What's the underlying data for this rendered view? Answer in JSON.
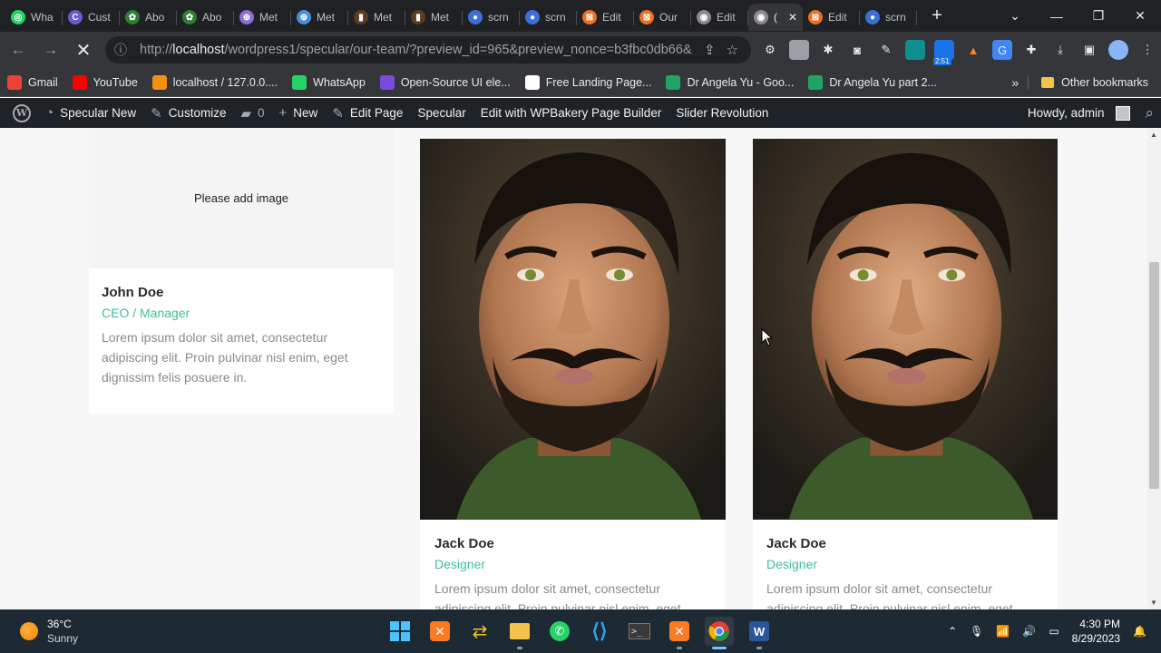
{
  "browser": {
    "tabs": [
      {
        "title": "Wha",
        "color": "#25d366",
        "glyph": "◎"
      },
      {
        "title": "Cust",
        "color": "#6a5acd",
        "glyph": "C"
      },
      {
        "title": "Abo",
        "color": "#2e7d32",
        "glyph": "✿"
      },
      {
        "title": "Abo",
        "color": "#2e7d32",
        "glyph": "✿"
      },
      {
        "title": "Met",
        "color": "#8e6bd6",
        "glyph": "⊕"
      },
      {
        "title": "Met",
        "color": "#4a90d9",
        "glyph": "⊕"
      },
      {
        "title": "Met",
        "color": "#5c3d1e",
        "glyph": "▮"
      },
      {
        "title": "Met",
        "color": "#5c3d1e",
        "glyph": "▮"
      },
      {
        "title": "scrn",
        "color": "#3b6fd6",
        "glyph": "●"
      },
      {
        "title": "scrn",
        "color": "#3b6fd6",
        "glyph": "●"
      },
      {
        "title": "Edit",
        "color": "#f26d21",
        "glyph": "⊠"
      },
      {
        "title": "Our",
        "color": "#f26d21",
        "glyph": "⊠"
      },
      {
        "title": "Edit",
        "color": "#8a8a8a",
        "glyph": "◉"
      },
      {
        "title": "(",
        "color": "#8a8a8a",
        "glyph": "◉",
        "active": true
      },
      {
        "title": "Edit",
        "color": "#f26d21",
        "glyph": "⊠"
      },
      {
        "title": "scrn",
        "color": "#3b6fd6",
        "glyph": "●"
      }
    ],
    "new_tab": "+",
    "window_controls": {
      "dropdown": "⌄",
      "minimize": "—",
      "restore": "❐",
      "close": "✕"
    },
    "url_prefix": "http://",
    "url_host": "localhost",
    "url_rest": "/wordpress1/specular/our-team/?preview_id=965&preview_nonce=b3fbc0db66&...",
    "extension_badge": "2:51",
    "bookmarks": [
      {
        "label": "Gmail",
        "color": "#ea4335"
      },
      {
        "label": "YouTube",
        "color": "#ff0000"
      },
      {
        "label": "localhost / 127.0.0....",
        "color": "#f29111"
      },
      {
        "label": "WhatsApp",
        "color": "#25d366"
      },
      {
        "label": "Open-Source UI ele...",
        "color": "#7b4be0"
      },
      {
        "label": "Free Landing Page...",
        "color": "#ffffff"
      },
      {
        "label": "Dr Angela Yu - Goo...",
        "color": "#1fa463"
      },
      {
        "label": "Dr Angela Yu part 2...",
        "color": "#1fa463"
      }
    ],
    "bookmarks_more": "»",
    "other_bookmarks": "Other bookmarks"
  },
  "admin_bar": {
    "site_name": "Specular New",
    "customize": "Customize",
    "comments_count": "0",
    "new": "New",
    "edit_page": "Edit Page",
    "theme": "Specular",
    "wpbakery": "Edit with WPBakery Page Builder",
    "slider": "Slider Revolution",
    "howdy": "Howdy, admin"
  },
  "team": [
    {
      "name": "John Doe",
      "role": "CEO / Manager",
      "bio": "Lorem ipsum dolor sit amet, consectetur adipiscing elit. Proin pulvinar nisl enim, eget dignissim felis posuere in.",
      "image_placeholder": "Please add image"
    },
    {
      "name": "Jack Doe",
      "role": "Designer",
      "bio": "Lorem ipsum dolor sit amet, consectetur adipiscing elit. Proin pulvinar nisl enim, eget"
    },
    {
      "name": "Jack Doe",
      "role": "Designer",
      "bio": "Lorem ipsum dolor sit amet, consectetur adipiscing elit. Proin pulvinar nisl enim, eget"
    }
  ],
  "taskbar": {
    "temperature": "36°C",
    "weather": "Sunny",
    "time": "4:30 PM",
    "date": "8/29/2023"
  },
  "colors": {
    "accent": "#3bbf9b",
    "admin_bar": "#1d2327",
    "browser_dark": "#202124"
  }
}
